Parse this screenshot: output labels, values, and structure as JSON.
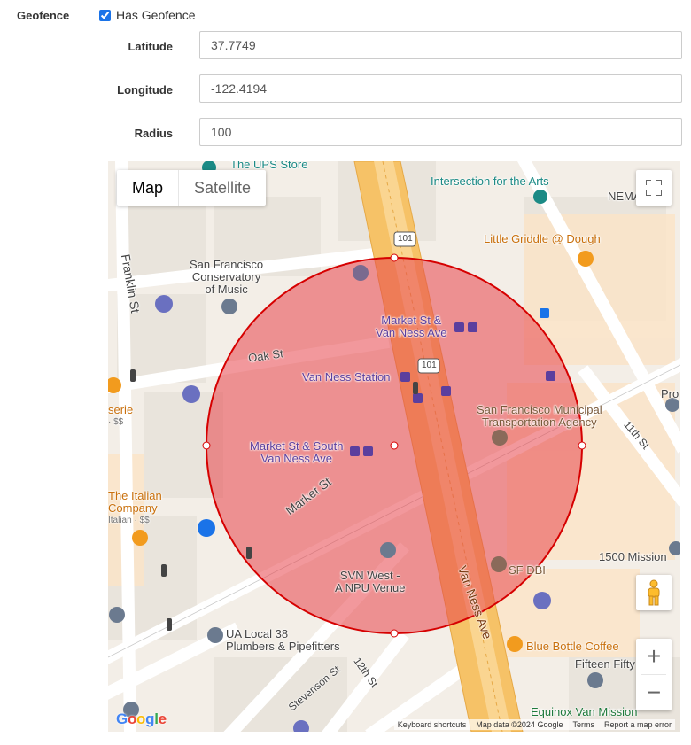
{
  "geofence": {
    "section_label": "Geofence",
    "checkbox_label": "Has Geofence",
    "checked": true
  },
  "fields": {
    "latitude": {
      "label": "Latitude",
      "value": "37.7749"
    },
    "longitude": {
      "label": "Longitude",
      "value": "-122.4194"
    },
    "radius": {
      "label": "Radius",
      "value": "100"
    }
  },
  "map": {
    "type_map": "Map",
    "type_satellite": "Satellite",
    "zoom_in": "+",
    "zoom_out": "−",
    "footer": {
      "shortcuts": "Keyboard shortcuts",
      "data": "Map data ©2024 Google",
      "terms": "Terms",
      "report": "Report a map error"
    },
    "geofence_fill": "#e8434a",
    "geofence_stroke": "#d60000",
    "labels": {
      "ups_store": "The UPS Store",
      "intersection_arts": "Intersection for the Arts",
      "nema": "NEMA",
      "little_griddle": "Little Griddle @ Dough",
      "franklin_st": "Franklin St",
      "conservatory_1": "San Francisco",
      "conservatory_2": "Conservatory",
      "conservatory_3": "of Music",
      "market_van_ness_1": "Market St &",
      "market_van_ness_2": "Van Ness Ave",
      "oak_st": "Oak St",
      "van_ness_station": "Van Ness Station",
      "sfmta_1": "San Francisco Municipal",
      "sfmta_2": "Transportation Agency",
      "eleventh_st": "11th St",
      "pro": "Pro",
      "serie": "serie",
      "serie_sub": "· $$",
      "market_south_1": "Market St & South",
      "market_south_2": "Van Ness Ave",
      "market_st": "Market St",
      "italian_1": "The Italian",
      "italian_2": "Company",
      "italian_sub": "Italian · $$",
      "svn_1": "SVN West -",
      "svn_2": "A NPU Venue",
      "van_ness_ave": "Van Ness Ave",
      "sf_dbi": "SF DBI",
      "mission_1500": "1500 Mission",
      "ua_local_1": "UA Local 38",
      "ua_local_2": "Plumbers & Pipefitters",
      "blue_bottle": "Blue Bottle Coffee",
      "fifteen_fifty": "Fifteen Fifty",
      "stevenson_st": "Stevenson St",
      "twelfth_st": "12th St",
      "equinox": "Equinox Van Mission",
      "us101": "101"
    }
  }
}
